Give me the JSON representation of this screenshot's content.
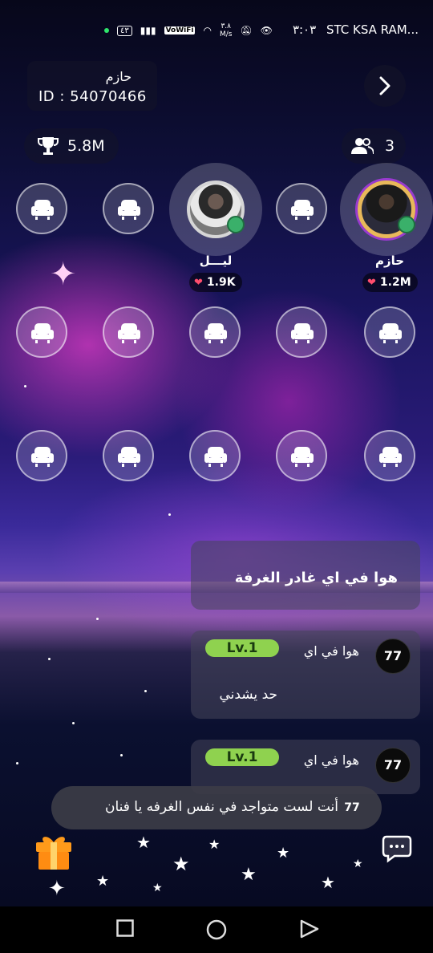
{
  "status_bar": {
    "carrier": "STC KSA RAM...",
    "time": "٣:٠٣",
    "net_speed_value": "٣.٨",
    "net_speed_unit": "M/s",
    "vowifi": "VoWiFi",
    "battery_label": "٤٣"
  },
  "room": {
    "host_name": "حازم",
    "host_id": "ID : 54070466",
    "trophy_value": "5.8M",
    "users_count": "3"
  },
  "speakers": [
    {
      "name": "حازم",
      "hearts": "1.2M"
    },
    {
      "name": "ليـــل",
      "hearts": "1.9K"
    }
  ],
  "chat": {
    "messages": [
      {
        "text": "هوا في اي غادر الغرفة"
      },
      {
        "sender": "هوا في اي",
        "level": "Lv.1",
        "text": "حد يشدني"
      },
      {
        "sender": "هوا في اي",
        "level": "Lv.1"
      }
    ]
  },
  "toast": {
    "text": "أنت لست متواجد في نفس الغرفه يا فنان"
  },
  "icons": {
    "next": "chevron-right-icon",
    "trophy": "trophy-icon",
    "users": "users-icon",
    "seat": "sofa-icon",
    "gift": "gift-icon",
    "chat": "chat-bubble-icon"
  },
  "colors": {
    "level_badge": "#8fd24f",
    "heart": "#ff4d6d",
    "mic_active": "#3ab06a"
  }
}
